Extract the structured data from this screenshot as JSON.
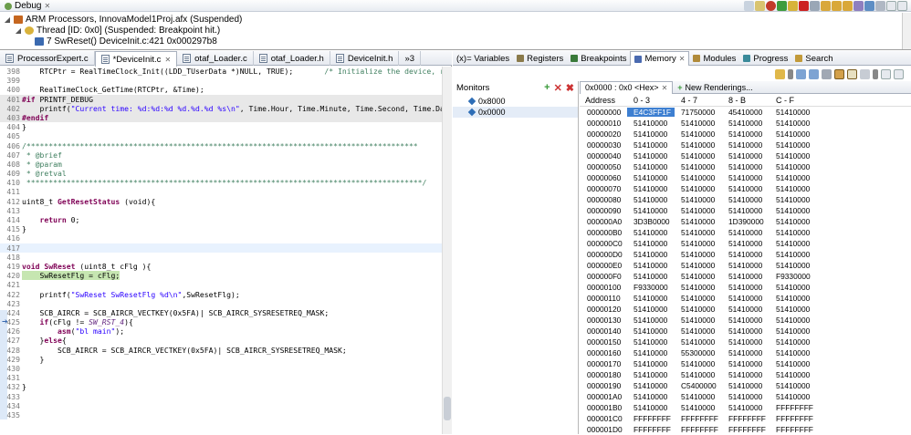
{
  "debug": {
    "tab_label": "Debug",
    "tree": [
      {
        "label": "ARM Processors, InnovaModel1Proj.afx (Suspended)",
        "indent": 0
      },
      {
        "label": "Thread [ID: 0x0] (Suspended: Breakpoint hit.)",
        "indent": 1
      },
      {
        "label": "7 SwReset() DeviceInit.c:421 0x000297b8",
        "indent": 2
      }
    ]
  },
  "editor": {
    "tabs": [
      {
        "label": "ProcessorExpert.c",
        "active": false
      },
      {
        "label": "*DeviceInit.c",
        "active": true
      },
      {
        "label": "otaf_Loader.c",
        "active": false
      },
      {
        "label": "otaf_Loader.h",
        "active": false
      },
      {
        "label": "DeviceInit.h",
        "active": false
      },
      {
        "label": "»3",
        "active": false
      }
    ],
    "lines": [
      {
        "n": "398",
        "h": "",
        "seg": [
          [
            "",
            "    RTCPtr = RealTimeClock_Init((LDD_TUserData *)NULL, TRUE);       "
          ],
          [
            "cm",
            "/* Initialize the device, reset "
          ]
        ]
      },
      {
        "n": "399",
        "h": "",
        "seg": [
          [
            "",
            ""
          ]
        ]
      },
      {
        "n": "400",
        "h": "",
        "seg": [
          [
            "",
            "    RealTimeClock_GetTime(RTCPtr, &Time);"
          ]
        ]
      },
      {
        "n": "401",
        "h": "grey",
        "seg": [
          [
            "kw",
            "#if"
          ],
          [
            "",
            " PRINTF_DEBUG"
          ]
        ]
      },
      {
        "n": "402",
        "h": "grey",
        "seg": [
          [
            "",
            "    printf("
          ],
          [
            "st",
            "\"Current time: %d:%d:%d %d.%d.%d %s\\n\""
          ],
          [
            "",
            ", Time.Hour, Time.Minute, Time.Second, Time.Day, Time"
          ]
        ]
      },
      {
        "n": "403",
        "h": "grey",
        "seg": [
          [
            "kw",
            "#endif"
          ]
        ]
      },
      {
        "n": "404",
        "h": "",
        "seg": [
          [
            "",
            "}"
          ]
        ]
      },
      {
        "n": "405",
        "h": "",
        "seg": [
          [
            "",
            ""
          ]
        ]
      },
      {
        "n": "406",
        "h": "",
        "seg": [
          [
            "cm",
            "/****************************************************************************************"
          ]
        ]
      },
      {
        "n": "407",
        "h": "",
        "seg": [
          [
            "cm",
            " * @brief"
          ]
        ]
      },
      {
        "n": "408",
        "h": "",
        "seg": [
          [
            "cm",
            " * @param"
          ]
        ]
      },
      {
        "n": "409",
        "h": "",
        "seg": [
          [
            "cm",
            " * @retval"
          ]
        ]
      },
      {
        "n": "410",
        "h": "",
        "seg": [
          [
            "cm",
            " *****************************************************************************************/"
          ]
        ]
      },
      {
        "n": "411",
        "h": "",
        "seg": [
          [
            "",
            ""
          ]
        ]
      },
      {
        "n": "412",
        "h": "",
        "seg": [
          [
            "",
            "uint8_t "
          ],
          [
            "kw",
            "GetResetStatus"
          ],
          [
            "",
            " (void){"
          ]
        ]
      },
      {
        "n": "413",
        "h": "",
        "seg": [
          [
            "",
            ""
          ]
        ]
      },
      {
        "n": "414",
        "h": "",
        "seg": [
          [
            "",
            "    "
          ],
          [
            "kw",
            "return"
          ],
          [
            "",
            " 0;"
          ]
        ]
      },
      {
        "n": "415",
        "h": "",
        "seg": [
          [
            "",
            "}"
          ]
        ]
      },
      {
        "n": "416",
        "h": "",
        "seg": [
          [
            "",
            ""
          ]
        ]
      },
      {
        "n": "417",
        "h": "current",
        "seg": [
          [
            "",
            ""
          ]
        ]
      },
      {
        "n": "418",
        "h": "",
        "seg": [
          [
            "",
            ""
          ]
        ]
      },
      {
        "n": "419",
        "h": "",
        "seg": [
          [
            "kw",
            "void"
          ],
          [
            "",
            " "
          ],
          [
            "kw",
            "SwReset"
          ],
          [
            "",
            " (uint8_t cFlg ){"
          ]
        ]
      },
      {
        "n": "420",
        "h": "green",
        "seg": [
          [
            "",
            "    SwResetFlg = cFlg;"
          ]
        ]
      },
      {
        "n": "421",
        "h": "",
        "seg": [
          [
            "",
            ""
          ]
        ]
      },
      {
        "n": "422",
        "h": "",
        "seg": [
          [
            "",
            "    printf("
          ],
          [
            "st",
            "\"SwReset SwResetFlg %d\\n\""
          ],
          [
            "",
            ",SwResetFlg);"
          ]
        ]
      },
      {
        "n": "423",
        "h": "",
        "seg": [
          [
            "",
            ""
          ]
        ]
      },
      {
        "n": "424",
        "h": "",
        "seg": [
          [
            "",
            "    SCB_AIRCR = SCB_AIRCR_VECTKEY(0x5FA)| SCB_AIRCR_SYSRESETREQ_MASK;"
          ]
        ]
      },
      {
        "n": "425",
        "h": "",
        "seg": [
          [
            "",
            "    "
          ],
          [
            "kw",
            "if"
          ],
          [
            "",
            "(cFlg != "
          ],
          [
            "mc",
            "SW_RST_4"
          ],
          [
            "",
            "){"
          ]
        ]
      },
      {
        "n": "426",
        "h": "",
        "seg": [
          [
            "",
            "        "
          ],
          [
            "kw",
            "asm"
          ],
          [
            "",
            "("
          ],
          [
            "st",
            "\"bl main\""
          ],
          [
            "",
            ");"
          ]
        ]
      },
      {
        "n": "427",
        "h": "",
        "seg": [
          [
            "",
            "    }"
          ],
          [
            "kw",
            "else"
          ],
          [
            "",
            "{"
          ]
        ]
      },
      {
        "n": "428",
        "h": "",
        "seg": [
          [
            "",
            "        SCB_AIRCR = SCB_AIRCR_VECTKEY(0x5FA)| SCB_AIRCR_SYSRESETREQ_MASK;"
          ]
        ]
      },
      {
        "n": "429",
        "h": "",
        "seg": [
          [
            "",
            "    }"
          ]
        ]
      },
      {
        "n": "430",
        "h": "",
        "seg": [
          [
            "",
            ""
          ]
        ]
      },
      {
        "n": "431",
        "h": "",
        "seg": [
          [
            "",
            ""
          ]
        ]
      },
      {
        "n": "432",
        "h": "",
        "seg": [
          [
            "",
            "}"
          ]
        ]
      },
      {
        "n": "433",
        "h": "",
        "seg": [
          [
            "",
            ""
          ]
        ]
      },
      {
        "n": "434",
        "h": "",
        "seg": [
          [
            "",
            ""
          ]
        ]
      },
      {
        "n": "435",
        "h": "",
        "seg": [
          [
            "",
            ""
          ]
        ]
      }
    ]
  },
  "right": {
    "tabs": [
      {
        "label": "(x)= Variables",
        "active": false
      },
      {
        "label": "Registers",
        "active": false
      },
      {
        "label": "Breakpoints",
        "active": false
      },
      {
        "label": "Memory",
        "active": true
      },
      {
        "label": "Modules",
        "active": false
      },
      {
        "label": "Progress",
        "active": false
      },
      {
        "label": "Search",
        "active": false
      }
    ],
    "monitors_title": "Monitors",
    "monitors": [
      "0x8000",
      "0x0000"
    ],
    "memory_tabs": [
      "0x0000 : 0x0 <Hex>",
      "New Renderings..."
    ],
    "memory_headers": [
      "Address",
      "0 - 3",
      "4 - 7",
      "8 - B",
      "C - F"
    ],
    "memory_rows": [
      [
        "00000000",
        "E4C3FF1F",
        "71750000",
        "45410000",
        "51410000"
      ],
      [
        "00000010",
        "51410000",
        "51410000",
        "51410000",
        "51410000"
      ],
      [
        "00000020",
        "51410000",
        "51410000",
        "51410000",
        "51410000"
      ],
      [
        "00000030",
        "51410000",
        "51410000",
        "51410000",
        "51410000"
      ],
      [
        "00000040",
        "51410000",
        "51410000",
        "51410000",
        "51410000"
      ],
      [
        "00000050",
        "51410000",
        "51410000",
        "51410000",
        "51410000"
      ],
      [
        "00000060",
        "51410000",
        "51410000",
        "51410000",
        "51410000"
      ],
      [
        "00000070",
        "51410000",
        "51410000",
        "51410000",
        "51410000"
      ],
      [
        "00000080",
        "51410000",
        "51410000",
        "51410000",
        "51410000"
      ],
      [
        "00000090",
        "51410000",
        "51410000",
        "51410000",
        "51410000"
      ],
      [
        "000000A0",
        "3D3B0000",
        "51410000",
        "1D390000",
        "51410000"
      ],
      [
        "000000B0",
        "51410000",
        "51410000",
        "51410000",
        "51410000"
      ],
      [
        "000000C0",
        "51410000",
        "51410000",
        "51410000",
        "51410000"
      ],
      [
        "000000D0",
        "51410000",
        "51410000",
        "51410000",
        "51410000"
      ],
      [
        "000000E0",
        "51410000",
        "51410000",
        "51410000",
        "51410000"
      ],
      [
        "000000F0",
        "51410000",
        "51410000",
        "51410000",
        "F9330000"
      ],
      [
        "00000100",
        "F9330000",
        "51410000",
        "51410000",
        "51410000"
      ],
      [
        "00000110",
        "51410000",
        "51410000",
        "51410000",
        "51410000"
      ],
      [
        "00000120",
        "51410000",
        "51410000",
        "51410000",
        "51410000"
      ],
      [
        "00000130",
        "51410000",
        "51410000",
        "51410000",
        "51410000"
      ],
      [
        "00000140",
        "51410000",
        "51410000",
        "51410000",
        "51410000"
      ],
      [
        "00000150",
        "51410000",
        "51410000",
        "51410000",
        "51410000"
      ],
      [
        "00000160",
        "51410000",
        "55300000",
        "51410000",
        "51410000"
      ],
      [
        "00000170",
        "51410000",
        "51410000",
        "51410000",
        "51410000"
      ],
      [
        "00000180",
        "51410000",
        "51410000",
        "51410000",
        "51410000"
      ],
      [
        "00000190",
        "51410000",
        "C5400000",
        "51410000",
        "51410000"
      ],
      [
        "000001A0",
        "51410000",
        "51410000",
        "51410000",
        "51410000"
      ],
      [
        "000001B0",
        "51410000",
        "51410000",
        "51410000",
        "FFFFFFFF"
      ],
      [
        "000001C0",
        "FFFFFFFF",
        "FFFFFFFF",
        "FFFFFFFF",
        "FFFFFFFF"
      ],
      [
        "000001D0",
        "FFFFFFFF",
        "FFFFFFFF",
        "FFFFFFFF",
        "FFFFFFFF"
      ]
    ]
  }
}
